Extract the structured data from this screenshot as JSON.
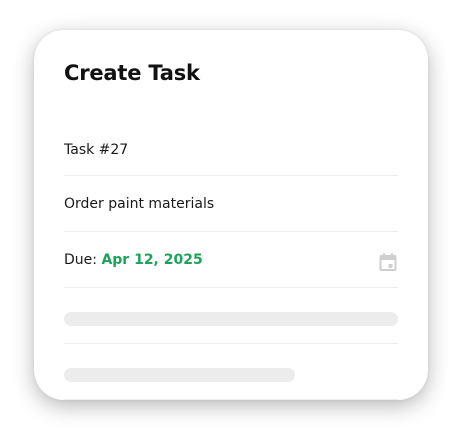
{
  "dialog": {
    "title": "Create Task",
    "task_id": "Task #27",
    "task_name": "Order paint materials",
    "due_label": "Due:",
    "due_date": "Apr 12, 2025",
    "calendar_icon": "calendar-icon"
  },
  "colors": {
    "accent_green": "#1aa35a",
    "skeleton": "#ececec",
    "icon_gray": "#c9c9c9"
  }
}
